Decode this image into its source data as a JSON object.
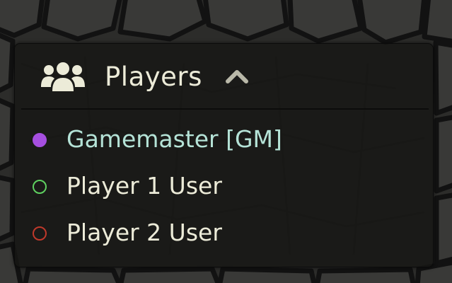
{
  "header": {
    "icon": "users-icon",
    "title": "Players",
    "toggle_icon": "chevron-up-icon"
  },
  "players": [
    {
      "name": "Gamemaster [GM]",
      "color": "#a64fe0",
      "filled": true,
      "text_color": "#b5e3d7"
    },
    {
      "name": "Player 1 User",
      "color": "#5fd160",
      "filled": false,
      "text_color": "#ecebd8"
    },
    {
      "name": "Player 2 User",
      "color": "#c0392b",
      "filled": false,
      "text_color": "#ecebd8"
    }
  ]
}
